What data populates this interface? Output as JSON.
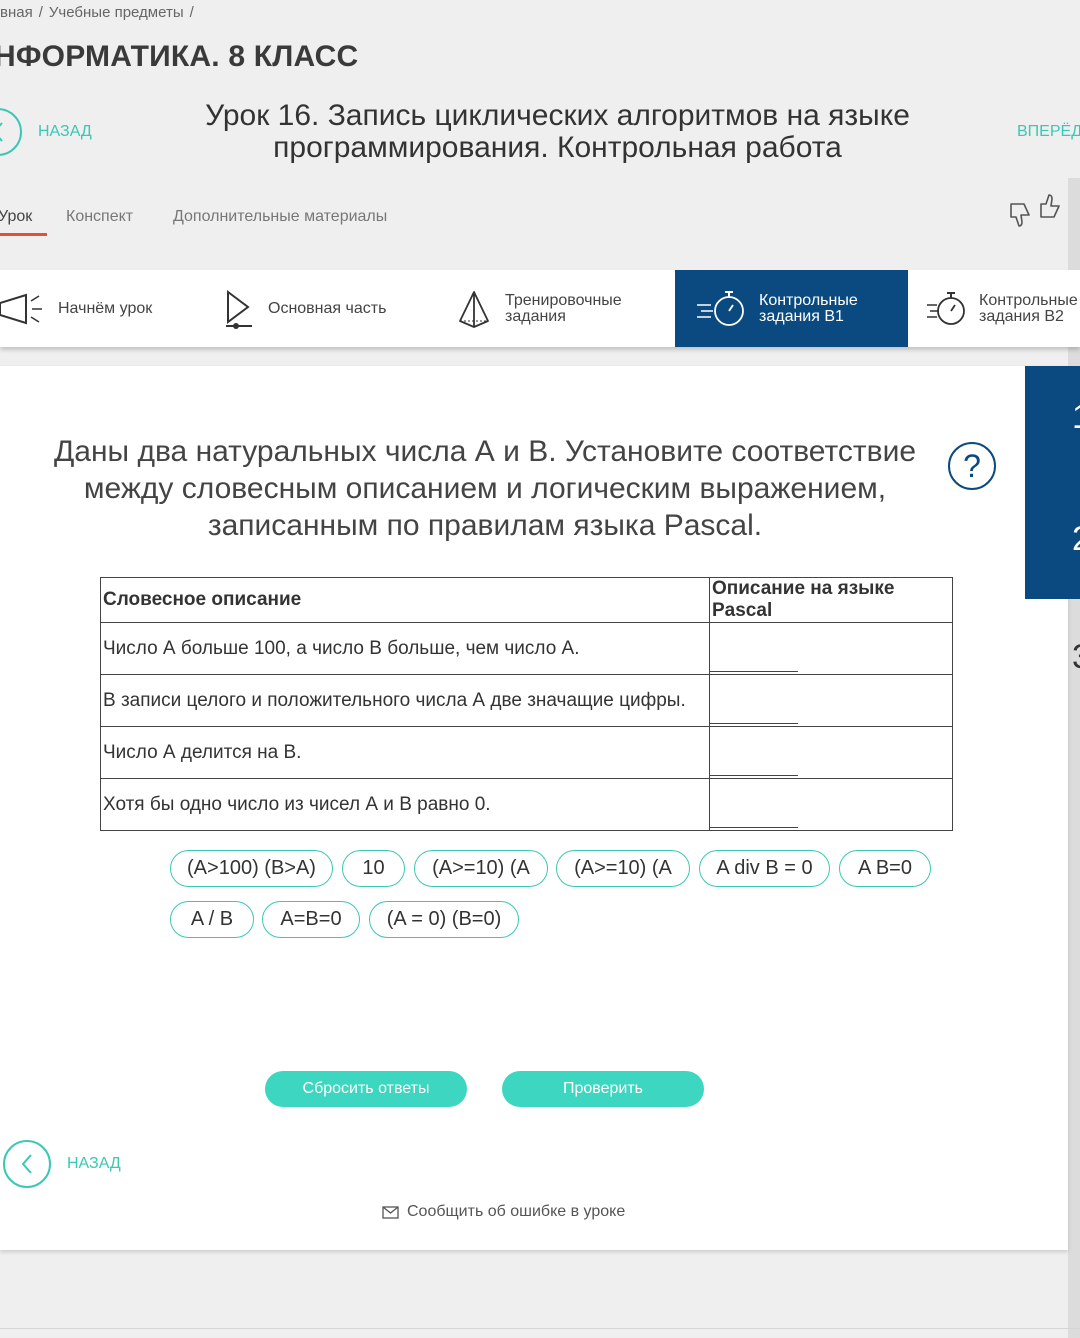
{
  "breadcrumb": {
    "item1": "вная",
    "sep": "/",
    "item2": "Учебные предметы"
  },
  "subject_title": "НФОРМАТИКА. 8 КЛАСС",
  "lesson_nav": {
    "back_label": "НАЗАД",
    "title": "Урок 16. Запись циклических алгоритмов на языке программирования. Контрольная работа",
    "forward_label": "ВПЕРЁД"
  },
  "tabs": [
    "Урок",
    "Конспект",
    "Дополнительные материалы"
  ],
  "steps": [
    {
      "label": "Начнём урок",
      "icon": "megaphone-icon"
    },
    {
      "label": "Основная часть",
      "icon": "play-icon"
    },
    {
      "label": "Тренировочные задания",
      "icon": "pyramid-icon"
    },
    {
      "label": "Контрольные задания В1",
      "icon": "stopwatch-icon",
      "active": true
    },
    {
      "label": "Контрольные задания В2",
      "icon": "stopwatch-icon"
    }
  ],
  "side_numbers": [
    "1",
    "2",
    "3"
  ],
  "question": "Даны два натуральных числа А и В. Установите соответствие между словесным описанием и логическим выражением, записанным по правилам языка Pascal.",
  "help_symbol": "?",
  "table": {
    "headers": [
      "Словесное описание",
      "Описание на языке Pascal"
    ],
    "rows": [
      "Число А больше 100, а число В больше, чем число А.",
      "В записи целого и положительного числа А две значащие цифры.",
      "Число А делится на В.",
      "Хотя бы одно число из чисел А и В равно 0."
    ]
  },
  "chips": [
    "(A>100) (B>A)",
    "10",
    "(A>=10) (A",
    "(A>=10) (A",
    "A div B = 0",
    "A B=0",
    "A / B",
    "A=B=0",
    "(A = 0) (B=0)"
  ],
  "buttons": {
    "reset": "Сбросить ответы",
    "check": "Проверить"
  },
  "bottom_back_label": "НАЗАД",
  "report_link": "Сообщить об ошибке в уроке",
  "colors": {
    "accent": "#3ac8b4",
    "active_tab": "#0b4a80",
    "underline": "#e0513a"
  }
}
